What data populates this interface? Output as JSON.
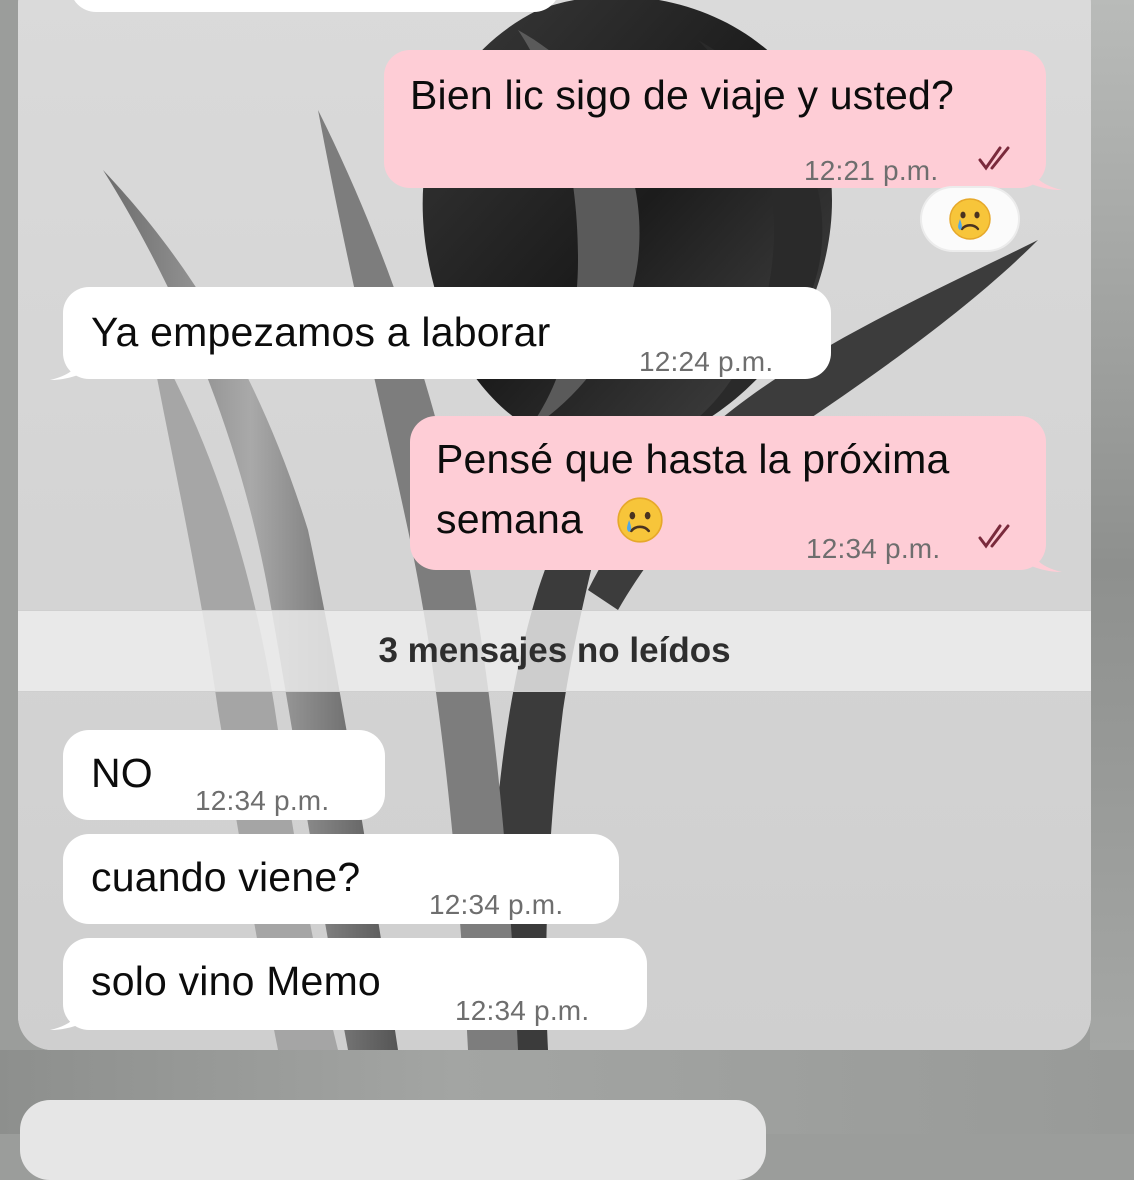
{
  "messages": [
    {
      "text": "Bien lic sigo de viaje y usted?",
      "time": "12:21 p.m.",
      "direction": "outgoing",
      "status": "read"
    },
    {
      "text": "Ya empezamos a laborar",
      "time": "12:24 p.m.",
      "direction": "incoming"
    },
    {
      "line1": "Pensé que hasta la próxima",
      "line2": "semana",
      "time": "12:34 p.m.",
      "direction": "outgoing",
      "status": "read",
      "emoji": "crying-face"
    },
    {
      "text": "NO",
      "time": "12:34 p.m.",
      "direction": "incoming"
    },
    {
      "text": "cuando viene?",
      "time": "12:34 p.m.",
      "direction": "incoming"
    },
    {
      "text": "solo vino Memo",
      "time": "12:34 p.m.",
      "direction": "incoming"
    }
  ],
  "reaction": {
    "emoji": "crying-face-icon"
  },
  "unread_divider": "3 mensajes no leídos",
  "colors": {
    "incoming": "#ffffff",
    "outgoing": "#fecdd6",
    "check": "#7a2a3c",
    "time": "#6e6e6e"
  }
}
